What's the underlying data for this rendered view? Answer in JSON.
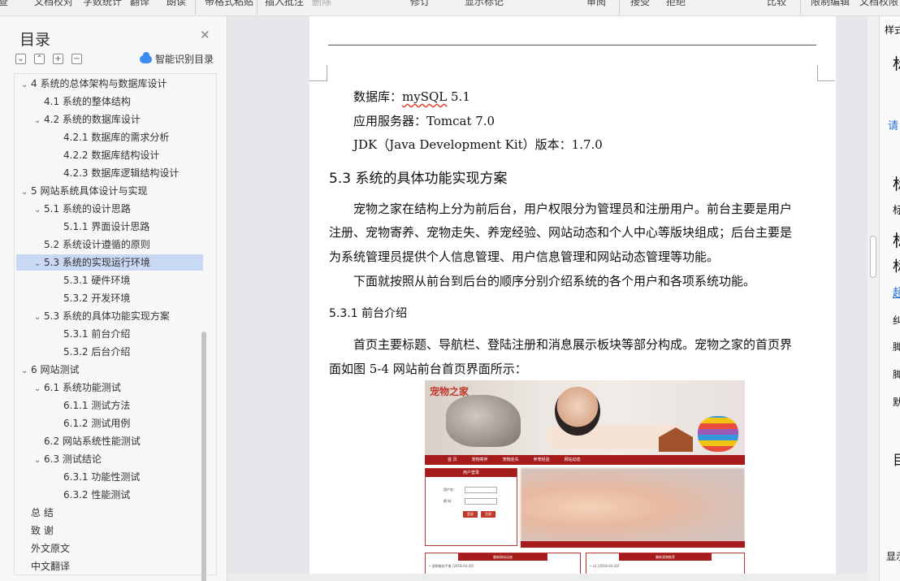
{
  "ribbon": {
    "items": [
      "查",
      "文档校对",
      "字数统计",
      "翻译",
      "朗读",
      "带格式粘贴",
      "插入批注",
      "删除",
      "修订",
      "显示标记",
      "审阅",
      "接受",
      "拒绝",
      "比较",
      "限制编辑",
      "文档权限"
    ]
  },
  "toc": {
    "title": "目录",
    "smart_label": "智能识别目录",
    "items": [
      {
        "text": "4 系统的总体架构与数据库设计",
        "level": 1,
        "caret": "v"
      },
      {
        "text": "4.1  系统的整体结构",
        "level": 2,
        "caret": ""
      },
      {
        "text": "4.2  系统的数据库设计",
        "level": 2,
        "caret": "v"
      },
      {
        "text": "4.2.1  数据库的需求分析",
        "level": 3,
        "caret": ""
      },
      {
        "text": "4.2.2  数据库结构设计",
        "level": 3,
        "caret": ""
      },
      {
        "text": "4.2.3 数据库逻辑结构设计",
        "level": 3,
        "caret": ""
      },
      {
        "text": "5 网站系统具体设计与实现",
        "level": 1,
        "caret": "v"
      },
      {
        "text": "5.1 系统的设计思路",
        "level": 2,
        "caret": "v"
      },
      {
        "text": "5.1.1 界面设计思路",
        "level": 3,
        "caret": ""
      },
      {
        "text": "5.2  系统设计遵循的原则",
        "level": 2,
        "caret": ""
      },
      {
        "text": "5.3  系统的实现运行环境",
        "level": 2,
        "caret": "v",
        "active": true
      },
      {
        "text": "5.3.1 硬件环境",
        "level": 3,
        "caret": ""
      },
      {
        "text": "5.3.2 开发环境",
        "level": 3,
        "caret": ""
      },
      {
        "text": "5.3  系统的具体功能实现方案",
        "level": 2,
        "caret": "v"
      },
      {
        "text": "5.3.1  前台介绍",
        "level": 3,
        "caret": ""
      },
      {
        "text": "5.3.2  后台介绍",
        "level": 3,
        "caret": ""
      },
      {
        "text": "6  网站测试",
        "level": 1,
        "caret": "v"
      },
      {
        "text": "6.1  系统功能测试",
        "level": 2,
        "caret": "v"
      },
      {
        "text": "6.1.1 测试方法",
        "level": 3,
        "caret": ""
      },
      {
        "text": "6.1.2 测试用例",
        "level": 3,
        "caret": ""
      },
      {
        "text": "6.2 网站系统性能测试",
        "level": 2,
        "caret": ""
      },
      {
        "text": "6.3 测试结论",
        "level": 2,
        "caret": "v"
      },
      {
        "text": "6.3.1  功能性测试",
        "level": 3,
        "caret": ""
      },
      {
        "text": "6.3.2  性能测试",
        "level": 3,
        "caret": ""
      },
      {
        "text": "总    结",
        "level": 1,
        "caret": ""
      },
      {
        "text": "致    谢",
        "level": 1,
        "caret": ""
      },
      {
        "text": "外文原文",
        "level": 1,
        "caret": ""
      },
      {
        "text": "中文翻译",
        "level": 1,
        "caret": ""
      }
    ]
  },
  "doc": {
    "line_db_label": "数据库：",
    "line_db_value": "mySQL",
    "line_db_ver": " 5.1",
    "line_server": "应用服务器：Tomcat 7.0",
    "line_jdk": "JDK（Java Development Kit）版本：1.7.0",
    "heading": "5.3  系统的具体功能实现方案",
    "para1_l1": "宠物之家在结构上分为前后台，用户权限分为管理员和注册用户。前台主要是用户",
    "para1_l2": "注册、宠物寄养、宠物走失、养宠经验、网站动态和个人中心等版块组成；后台主要是",
    "para1_l3": "为系统管理员提供个人信息管理、用户信息管理和网站动态管理等功能。",
    "para2": "下面就按照从前台到后台的顺序分别介绍系统的各个用户和各项系统功能。",
    "subheading": "5.3.1  前台介绍",
    "para3_l1": "首页主要标题、导航栏、登陆注册和消息展示板块等部分构成。宠物之家的首页界",
    "para3_l2": "面如图 5-4 网站前台首页界面所示："
  },
  "figure": {
    "logo": "宠物之家",
    "nav": [
      "首 页",
      "宠物寄养",
      "宠物走失",
      "养宠经验",
      "网站动态"
    ],
    "login_title": "用户登录",
    "user_label": "用户名：",
    "pwd_label": "密  码：",
    "btn_login": "登录",
    "btn_reg": "注册",
    "box1_title": "最新网站动态",
    "box1_row": "• 宠物服务手册                                        [2018-04-20]",
    "box2_title": "最新宠物推荐",
    "box2_row": "• a1                                                          [2018-04-20]"
  },
  "rpanel": {
    "lines": [
      "样式",
      "标",
      "请",
      "标",
      "标",
      "标",
      "标",
      "超",
      "纠",
      "脚",
      "脚",
      "默",
      "目",
      "显示"
    ]
  }
}
